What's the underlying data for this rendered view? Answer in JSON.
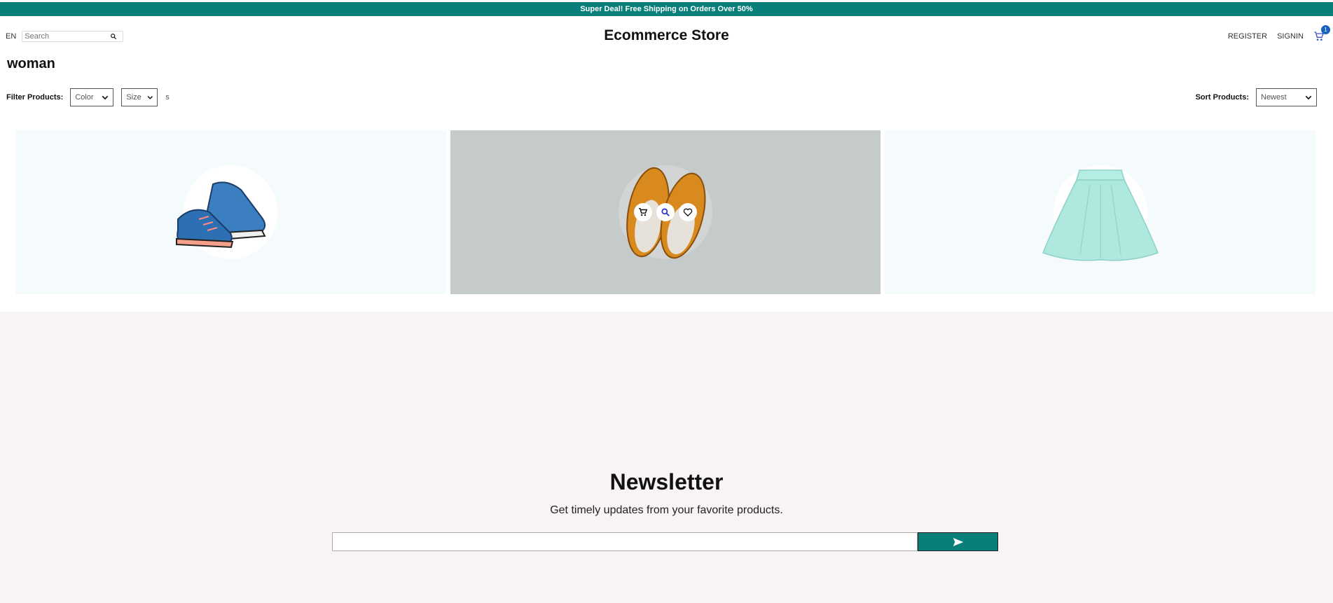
{
  "announcement": "Super Deal! Free Shipping on Orders Over 50%",
  "nav": {
    "language": "EN",
    "search_placeholder": "Search",
    "logo": "Ecommerce Store",
    "register": "REGISTER",
    "signin": "SIGNIN",
    "cart_count": "1"
  },
  "category": "woman",
  "filters": {
    "label": "Filter Products:",
    "color": "Color",
    "size": "Size",
    "extra": "s",
    "sort_label": "Sort Products:",
    "sort": "Newest"
  },
  "products": [
    {
      "name": "blue-sneakers"
    },
    {
      "name": "tan-leather-shoes"
    },
    {
      "name": "mint-skirt"
    }
  ],
  "newsletter": {
    "title": "Newsletter",
    "description": "Get timely updates from your favorite products.",
    "input_value": ""
  },
  "colors": {
    "brand": "#087f7a",
    "badge": "#1565c0",
    "newsletter_bg": "#f9f4f4"
  },
  "icons": [
    "search-icon",
    "cart-icon",
    "chevron-down-icon",
    "zoom-icon",
    "heart-icon",
    "send-icon"
  ]
}
